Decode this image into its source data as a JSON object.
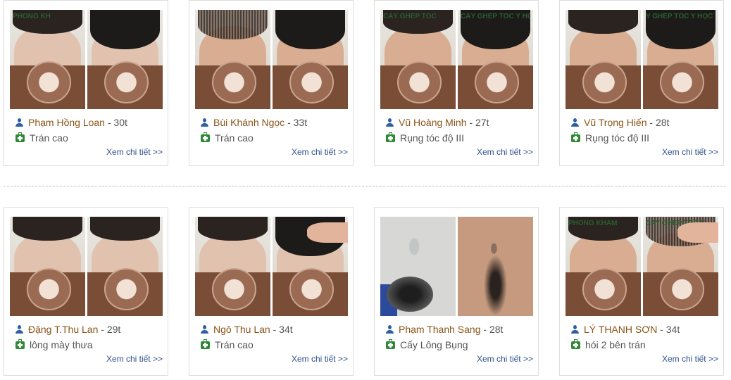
{
  "rows": [
    {
      "cards": [
        {
          "name": "Phạm Hồng Loan",
          "age": "30t",
          "diagnosis": "Trán cao",
          "link": "Xem chi tiết >>",
          "sign_left": "PHONG KH",
          "sign_right": ""
        },
        {
          "name": "Bùi Khánh Ngọc",
          "age": "33t",
          "diagnosis": "Trán cao",
          "link": "Xem chi tiết >>",
          "sign_left": "",
          "sign_right": ""
        },
        {
          "name": "Vũ Hoàng Minh",
          "age": "27t",
          "diagnosis": "Rụng tóc độ III",
          "link": "Xem chi tiết >>",
          "sign_left": "CẤY GHÉP TÓC",
          "sign_right": "CẤY GHÉP TÓC Y HỌC"
        },
        {
          "name": "Vũ Trọng Hiến",
          "age": "28t",
          "diagnosis": "Rụng tóc độ III",
          "link": "Xem chi tiết >>",
          "sign_left": "",
          "sign_right": "Y GHÉP TÓC Y HỌC"
        }
      ]
    },
    {
      "cards": [
        {
          "name": "Đặng T.Thu Lan",
          "age": "29t",
          "diagnosis": "lông mày thưa",
          "link": "Xem chi tiết >>",
          "sign_left": "",
          "sign_right": ""
        },
        {
          "name": "Ngô Thu Lan",
          "age": "34t",
          "diagnosis": "Trán cao",
          "link": "Xem chi tiết >>",
          "sign_left": "",
          "sign_right": ""
        },
        {
          "name": "Phạm Thanh Sang",
          "age": "28t",
          "diagnosis": "Cấy Lông Bụng",
          "link": "Xem chi tiết >>",
          "sign_left": "",
          "sign_right": ""
        },
        {
          "name": "LÝ THANH SƠN",
          "age": "34t",
          "diagnosis": "hói 2 bên trán",
          "link": "Xem chi tiết >>",
          "sign_left": "PHÒNG KHÁM",
          "sign_right": "CAY GHEP TOC Y"
        }
      ]
    }
  ],
  "age_separator": " - ",
  "icons": {
    "person": "user-icon",
    "diagnosis": "medkit-icon"
  },
  "colors": {
    "name": "#8a5417",
    "link": "#2c4f8f",
    "user_icon": "#2e5f9e",
    "kit_icon": "#2f8a36"
  }
}
